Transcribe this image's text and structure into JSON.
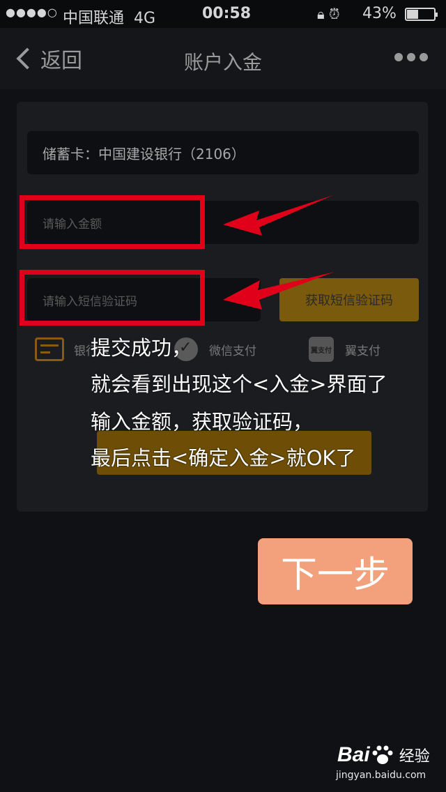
{
  "status_bar": {
    "signal": "●●●●○",
    "carrier": "中国联通",
    "network": "4G",
    "time": "00:58",
    "battery": "43%"
  },
  "nav": {
    "back_label": "返回",
    "title": "账户入金"
  },
  "form": {
    "bank_card": "储蓄卡：中国建设银行（2106）",
    "amount_placeholder": "请输入金额",
    "code_placeholder": "请输入短信验证码",
    "get_code_label": "获取短信验证码"
  },
  "payment_methods": [
    {
      "label": "银行卡"
    },
    {
      "label": "微信支付"
    },
    {
      "label": "翼支付",
      "icon_text": "翼支付"
    }
  ],
  "annotation": {
    "line1": "提交成功，",
    "line2": "就会看到出现这个<入金>界面了",
    "line3": "输入金额，获取验证码，",
    "line4": "最后点击<确定入金>就OK了"
  },
  "next_button_label": "下一步",
  "watermark": {
    "brand": "Bai",
    "brand_suffix": "经验",
    "url": "jingyan.baidu.com"
  },
  "colors": {
    "background": "#101114",
    "accent_gold": "#7a5a0c",
    "next_button": "#f3a07c",
    "annotation_red": "#e0001a"
  }
}
